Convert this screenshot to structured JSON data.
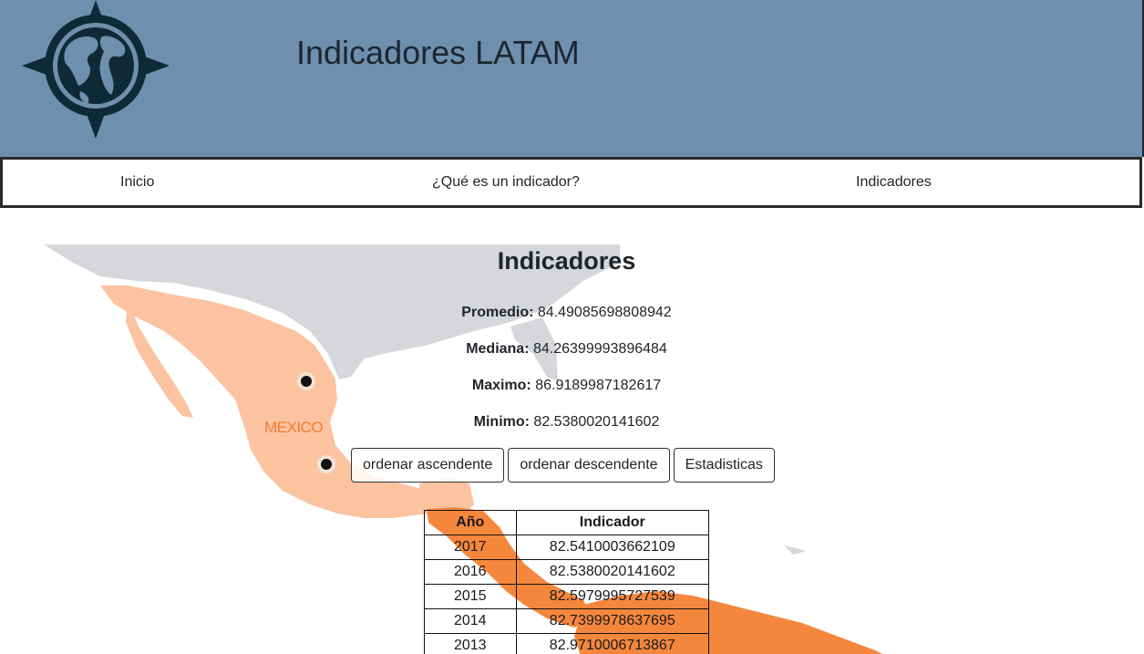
{
  "header": {
    "title": "Indicadores LATAM",
    "logo_icon": "compass-globe-icon",
    "background": "#6e90ae"
  },
  "nav": {
    "items": [
      {
        "label": "Inicio"
      },
      {
        "label": "¿Qué es un indicador?"
      },
      {
        "label": "Indicadores"
      }
    ]
  },
  "map": {
    "country_label": "MEXICO",
    "land_color": "#d5d7da",
    "mexico_color": "#fbc3a0",
    "central_america_color": "#f5873d"
  },
  "indicators": {
    "title": "Indicadores",
    "stats": [
      {
        "label": "Promedio:",
        "value": "84.49085698808942"
      },
      {
        "label": "Mediana:",
        "value": "84.26399993896484"
      },
      {
        "label": "Maximo:",
        "value": "86.9189987182617"
      },
      {
        "label": "Minimo:",
        "value": "82.5380020141602"
      }
    ],
    "buttons": {
      "asc": "ordenar ascendente",
      "desc": "ordenar descendente",
      "stats": "Estadisticas"
    },
    "table": {
      "headers": [
        "Año",
        "Indicador"
      ],
      "rows": [
        [
          "2017",
          "82.5410003662109"
        ],
        [
          "2016",
          "82.5380020141602"
        ],
        [
          "2015",
          "82.5979995727539"
        ],
        [
          "2014",
          "82.7399978637695"
        ],
        [
          "2013",
          "82.9710006713867"
        ]
      ]
    }
  }
}
